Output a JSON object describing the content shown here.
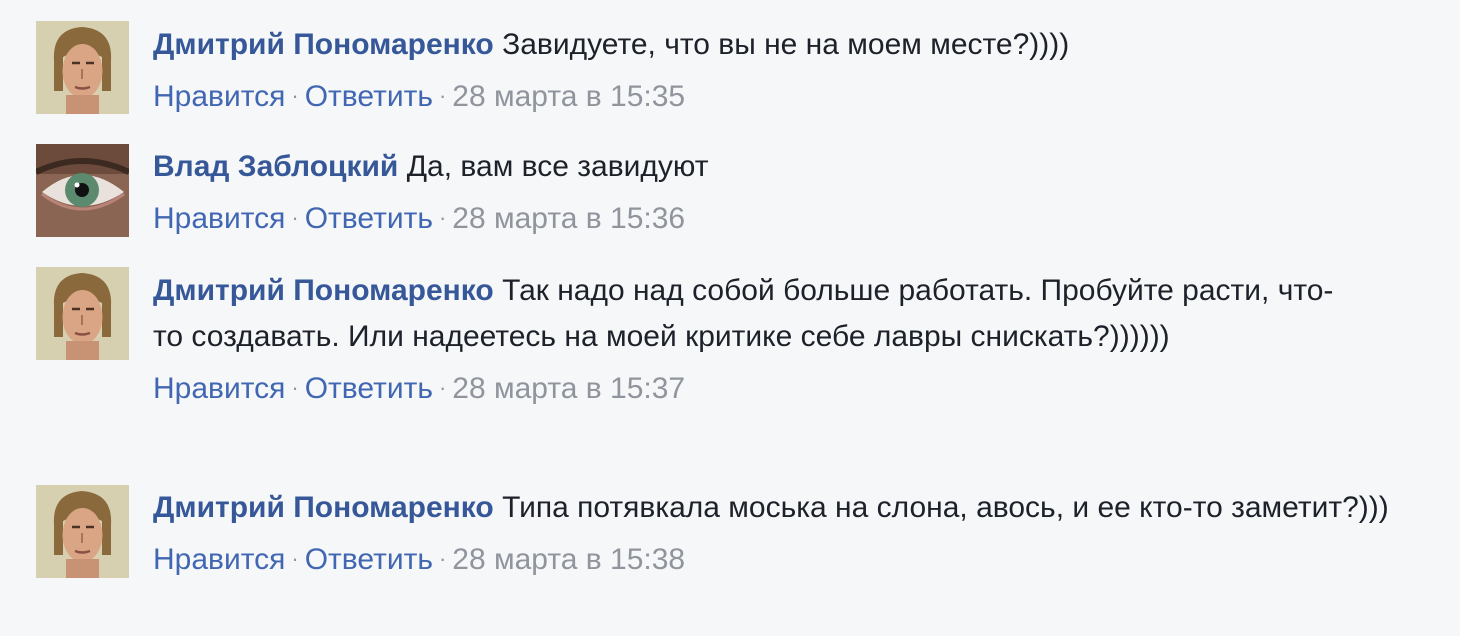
{
  "comments": [
    {
      "author": "Дмитрий Пономаренко",
      "text": "Завидуете, что вы не на моем месте?))))",
      "like": "Нравится",
      "reply": "Ответить",
      "time": "28 марта в 15:35",
      "avatar": "man-face-photo"
    },
    {
      "author": "Влад Заблоцкий",
      "text": "Да, вам все завидуют",
      "like": "Нравится",
      "reply": "Ответить",
      "time": "28 марта в 15:36",
      "avatar": "eye-photo"
    },
    {
      "author": "Дмитрий Пономаренко",
      "text": "Так надо над собой больше работать. Пробуйте расти, что-то создавать. Или надеетесь на моей критике себе лавры снискать?))))))",
      "like": "Нравится",
      "reply": "Ответить",
      "time": "28 марта в 15:37",
      "avatar": "man-face-photo"
    },
    {
      "author": "Дмитрий Пономаренко",
      "text": "Типа потявкала моська на слона, авось, и ее кто-то заметит?)))",
      "like": "Нравится",
      "reply": "Ответить",
      "time": "28 марта в 15:38",
      "avatar": "man-face-photo"
    }
  ],
  "separator": "·",
  "colors": {
    "background": "#f6f7f9",
    "author": "#365899",
    "action": "#4267b2",
    "meta": "#90949c",
    "text": "#1d2129"
  }
}
